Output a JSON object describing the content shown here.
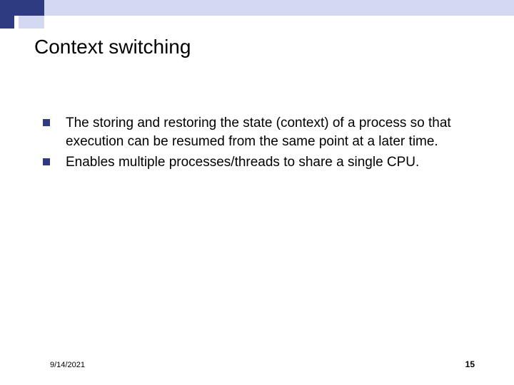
{
  "slide": {
    "title": "Context switching",
    "bullets": [
      "The storing and restoring the state (context) of a process so that execution can be resumed from the same point at a later time.",
      "Enables multiple processes/threads to share a single CPU."
    ],
    "date": "9/14/2021",
    "page_number": "15"
  }
}
